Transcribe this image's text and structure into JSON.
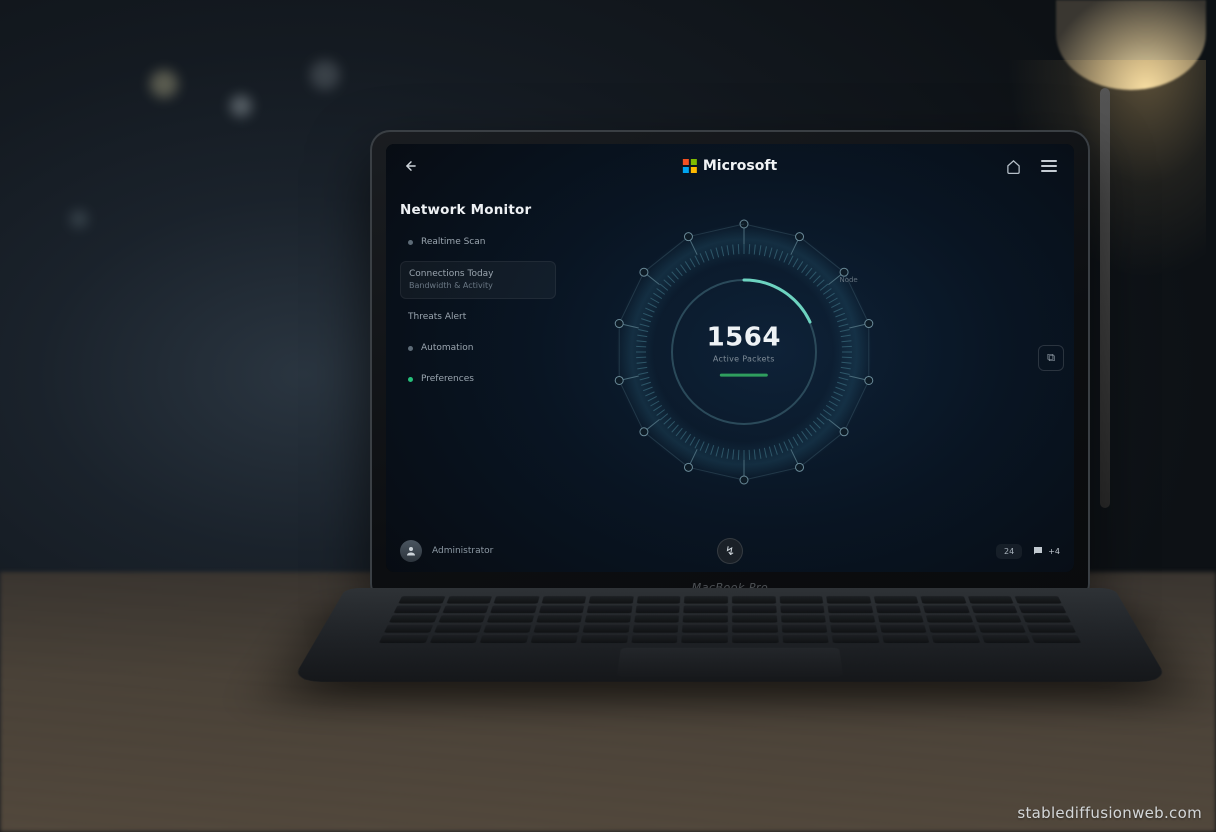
{
  "header": {
    "brand": "Microsoft",
    "back_aria": "Back"
  },
  "sidebar": {
    "title": "Network Monitor",
    "items": [
      {
        "label": "Realtime Scan",
        "sub": ""
      },
      {
        "label": "Connections Today",
        "sub": "Bandwidth & Activity"
      },
      {
        "label": "Threats Alert",
        "sub": ""
      },
      {
        "label": "Automation",
        "sub": ""
      },
      {
        "label": "Preferences",
        "sub": ""
      }
    ]
  },
  "dial": {
    "value": "1564",
    "caption": "Active Packets",
    "node_label": "Node"
  },
  "right_panel": {
    "glyph": "⧉"
  },
  "bottom": {
    "user_label": "Administrator",
    "center_glyph": "↯",
    "status_pill": "24",
    "chat_count": "+4"
  },
  "laptop": {
    "hinge_text": "MacBook Pro"
  },
  "watermark": "stablediffusionweb.com"
}
